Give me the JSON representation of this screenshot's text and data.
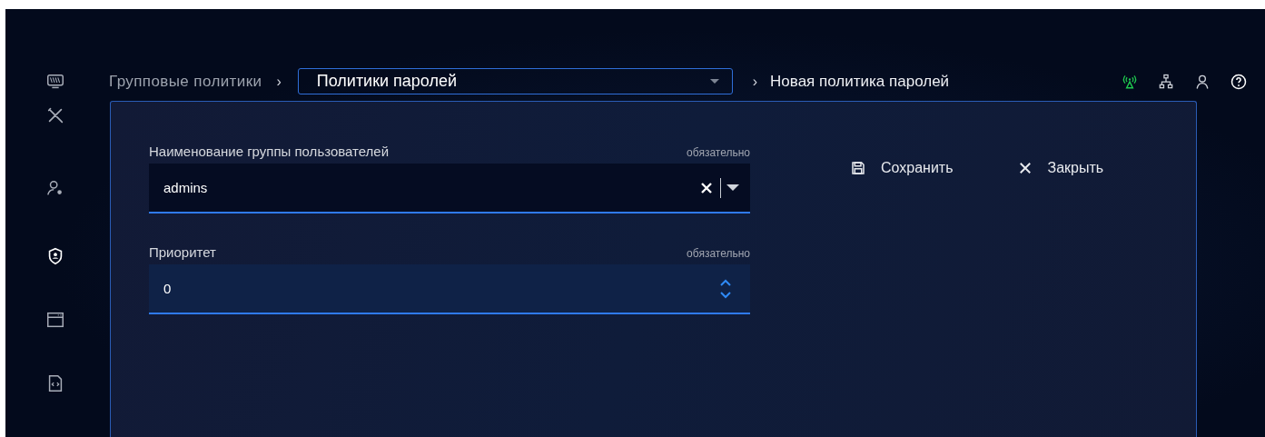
{
  "sidebar": {
    "items": [
      {
        "selected": false
      },
      {
        "selected": false
      },
      {
        "selected": false
      },
      {
        "selected": true
      },
      {
        "selected": false
      },
      {
        "selected": false
      }
    ]
  },
  "breadcrumb": {
    "parent": "Групповые политики",
    "separator_1": "›",
    "dropdown": {
      "value": "Политики паролей"
    },
    "separator_2": "›",
    "current": "Новая политика паролей"
  },
  "form": {
    "fields": [
      {
        "kind": "combo",
        "label": "Наименование группы пользователей",
        "hint": "обязательно",
        "value": "admins"
      },
      {
        "kind": "spin",
        "label": "Приоритет",
        "hint": "обязательно",
        "value": "0"
      }
    ],
    "actions": [
      {
        "label": "Сохранить"
      },
      {
        "label": "Закрыть"
      }
    ]
  }
}
